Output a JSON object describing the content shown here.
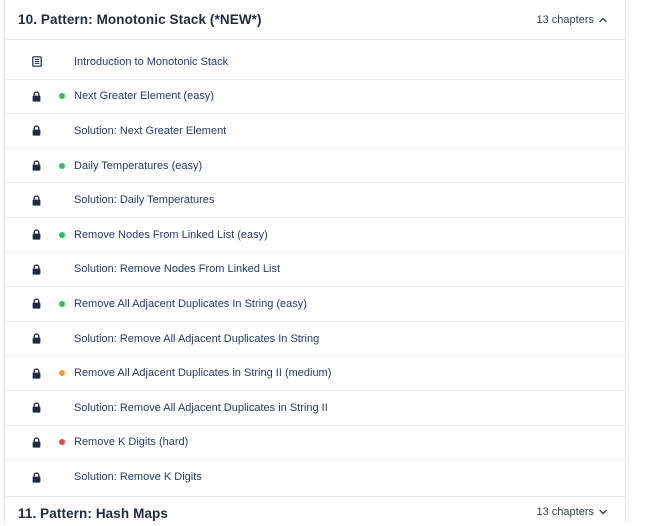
{
  "sections": [
    {
      "title": "10. Pattern: Monotonic Stack (*NEW*)",
      "meta": "13 chapters",
      "expanded": true
    },
    {
      "title": "11. Pattern: Hash Maps",
      "meta": "13 chapters",
      "expanded": false
    }
  ],
  "chapters": [
    {
      "label": "Introduction to Monotonic Stack",
      "icon": "document-icon",
      "dot": null
    },
    {
      "label": "Next Greater Element (easy)",
      "icon": "lock-icon",
      "dot": "#22c55e"
    },
    {
      "label": "Solution: Next Greater Element",
      "icon": "lock-icon",
      "dot": null
    },
    {
      "label": "Daily Temperatures (easy)",
      "icon": "lock-icon",
      "dot": "#22c55e"
    },
    {
      "label": "Solution: Daily Temperatures",
      "icon": "lock-icon",
      "dot": null
    },
    {
      "label": "Remove Nodes From Linked List (easy)",
      "icon": "lock-icon",
      "dot": "#22c55e"
    },
    {
      "label": "Solution: Remove Nodes From Linked List",
      "icon": "lock-icon",
      "dot": null
    },
    {
      "label": "Remove All Adjacent Duplicates In String (easy)",
      "icon": "lock-icon",
      "dot": "#22c55e"
    },
    {
      "label": "Solution: Remove All Adjacent Duplicates In String",
      "icon": "lock-icon",
      "dot": null
    },
    {
      "label": "Remove All Adjacent Duplicates in String II (medium)",
      "icon": "lock-icon",
      "dot": "#f59e0b"
    },
    {
      "label": "Solution: Remove All Adjacent Duplicates in String II",
      "icon": "lock-icon",
      "dot": null
    },
    {
      "label": "Remove K Digits (hard)",
      "icon": "lock-icon",
      "dot": "#ef4444"
    },
    {
      "label": "Solution: Remove K Digits",
      "icon": "lock-icon",
      "dot": null
    }
  ],
  "colors": {
    "title": "#1f2a44",
    "link": "#243a73",
    "easy": "#22c55e",
    "medium": "#f59e0b",
    "hard": "#ef4444",
    "icon": "#1f2a44"
  }
}
